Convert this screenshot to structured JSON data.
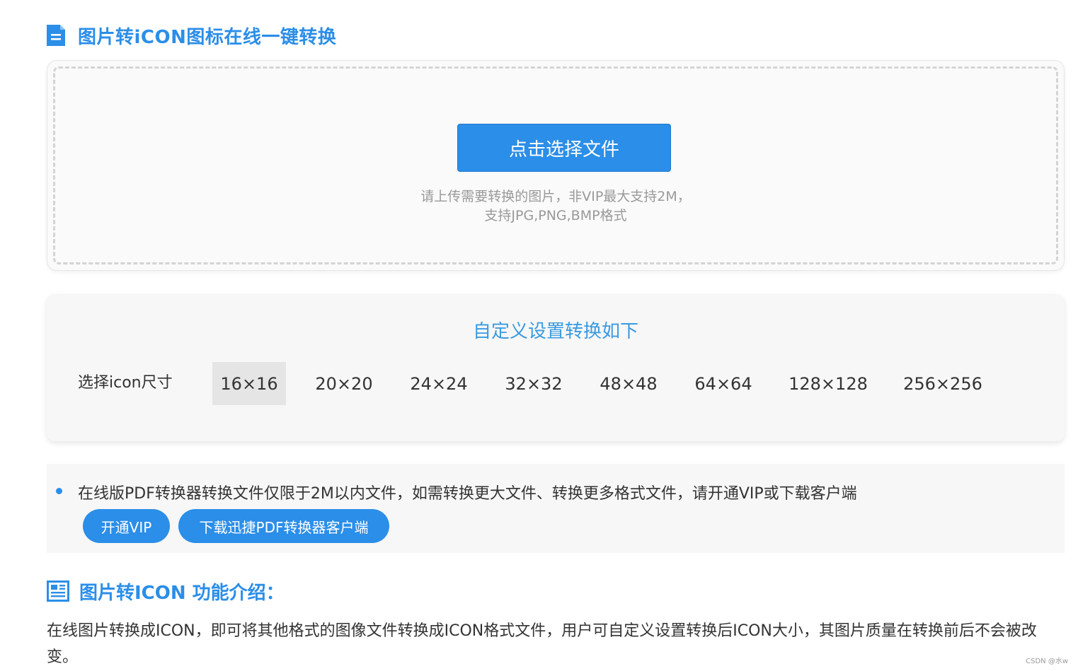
{
  "header": {
    "icon": "document-icon",
    "title": "图片转iCON图标在线一键转换"
  },
  "upload": {
    "button_label": "点击选择文件",
    "hint_line1": "请上传需要转换的图片，非VIP最大支持2M，",
    "hint_line2": "支持JPG,PNG,BMP格式"
  },
  "settings": {
    "title": "自定义设置转换如下",
    "size_label": "选择icon尺寸",
    "sizes": [
      "16×16",
      "20×20",
      "24×24",
      "32×32",
      "48×48",
      "64×64",
      "128×128",
      "256×256"
    ],
    "selected_size": "16×16"
  },
  "notice": {
    "text": "在线版PDF转换器转换文件仅限于2M以内文件，如需转换更大文件、转换更多格式文件，请开通VIP或下载客户端",
    "vip_button": "开通VIP",
    "download_button": "下载迅捷PDF转换器客户端"
  },
  "intro": {
    "icon": "newspaper-icon",
    "title": "图片转ICON 功能介绍：",
    "body": "在线图片转换成ICON，即可将其他格式的图像文件转换成ICON格式文件，用户可自定义设置转换后ICON大小，其图片质量在转换前后不会被改变。"
  },
  "watermark": "CSDN @水w",
  "colors": {
    "accent": "#2b8ee8",
    "selected_bg": "#e5e5e5"
  }
}
